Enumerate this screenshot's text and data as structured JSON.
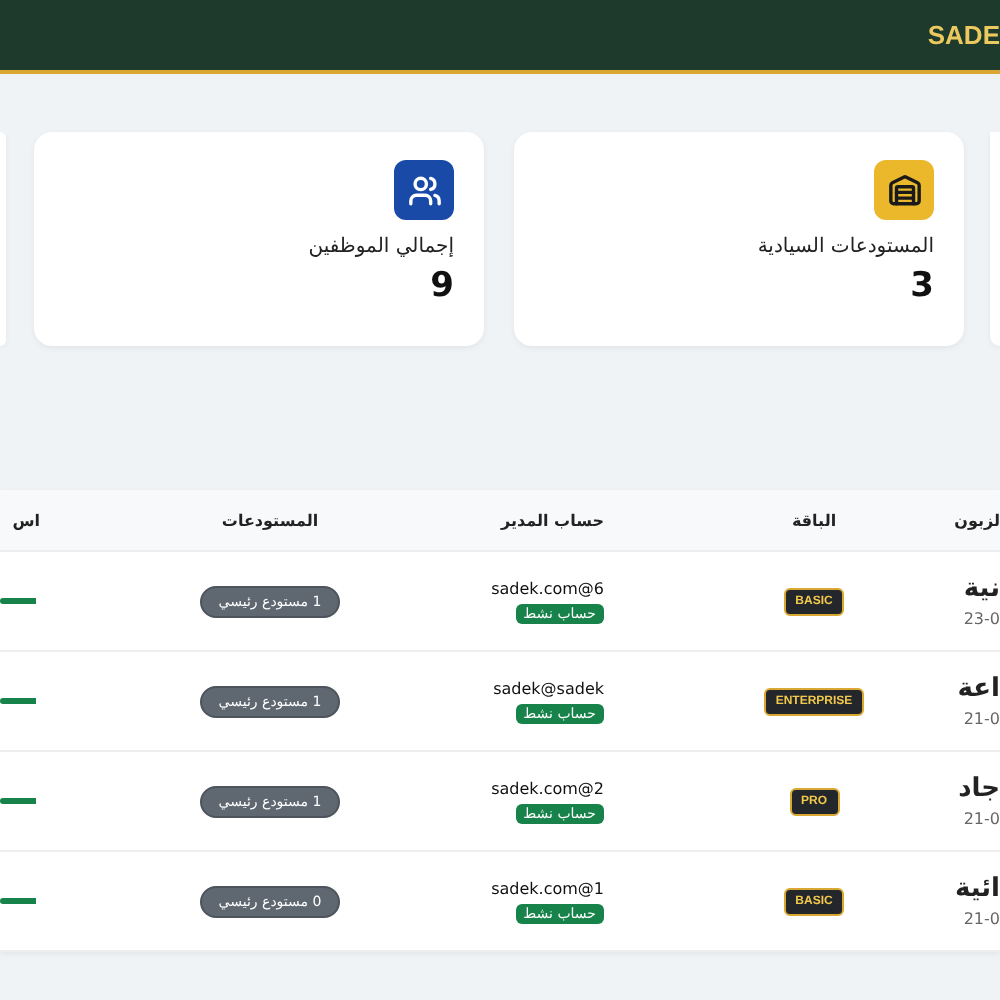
{
  "header": {
    "brand": "SADE"
  },
  "stats": [
    {
      "kind": "warehouse",
      "label": "المستودعات السيادية",
      "value": "3"
    },
    {
      "kind": "people",
      "label": "إجمالي الموظفين",
      "value": "9"
    }
  ],
  "table": {
    "columns": [
      "لزبون",
      "الباقة",
      "حساب المدير",
      "المستودعات",
      "اس"
    ],
    "rows": [
      {
        "customer": "نية",
        "date": "23-0",
        "package": "BASIC",
        "manager": "sadek.com@6",
        "status": "حساب نشط",
        "warehouses": "1 مستودع رئيسي"
      },
      {
        "customer": "اعة",
        "date": "21-0",
        "package": "ENTERPRISE",
        "manager": "sadek@sadek",
        "status": "حساب نشط",
        "warehouses": "1 مستودع رئيسي"
      },
      {
        "customer": "جاد",
        "date": "21-0",
        "package": "PRO",
        "manager": "sadek.com@2",
        "status": "حساب نشط",
        "warehouses": "1 مستودع رئيسي"
      },
      {
        "customer": "ائية",
        "date": "21-0",
        "package": "BASIC",
        "manager": "sadek.com@1",
        "status": "حساب نشط",
        "warehouses": "0 مستودع رئيسي"
      }
    ]
  }
}
